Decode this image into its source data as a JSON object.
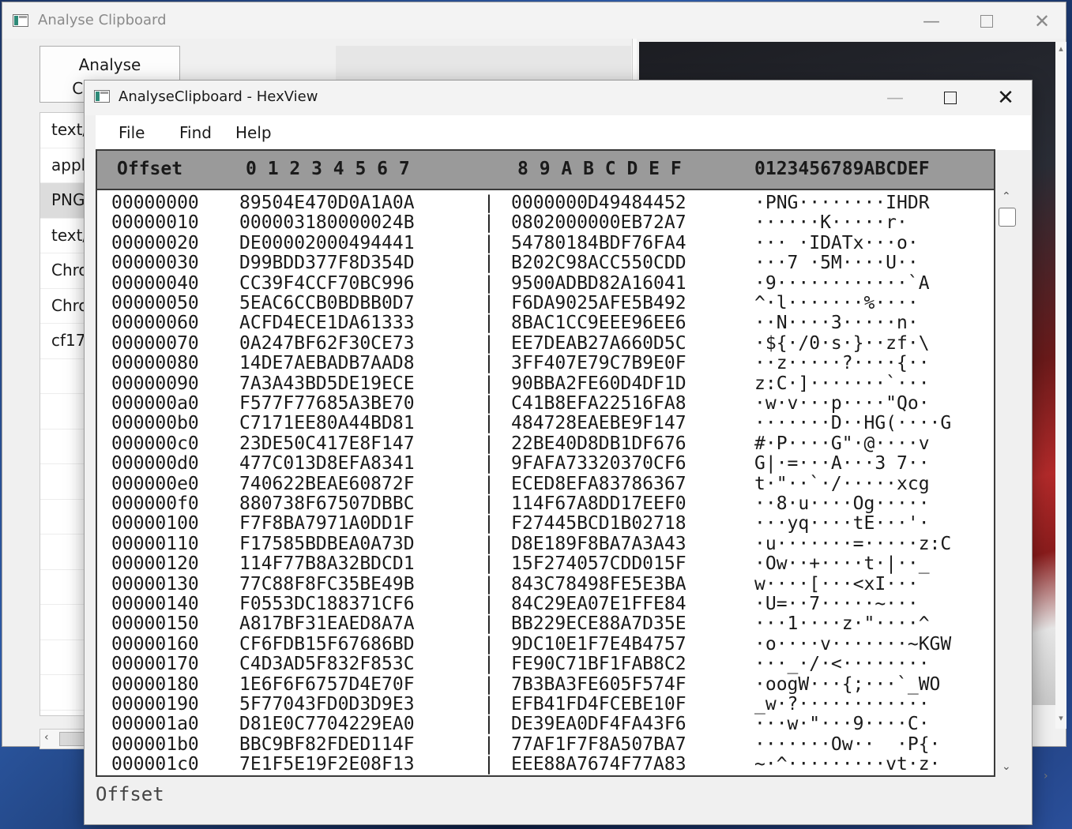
{
  "back_window": {
    "title": "Analyse Clipboard",
    "analyse_button": "Analyse\nClipboard",
    "types": [
      "text/",
      "appl",
      "PNG",
      "text/",
      "Chro",
      "Chro",
      "cf17"
    ],
    "selected_index": 2
  },
  "hexview": {
    "title": "AnalyseClipboard - HexView",
    "menu": [
      "File",
      "Find",
      "Help"
    ],
    "header": {
      "offset": "Offset",
      "cols_low": "0 1 2 3 4 5 6 7",
      "cols_high": "8 9 A B C D E F",
      "ascii": "0123456789ABCDEF"
    },
    "separator": "|",
    "rows": [
      {
        "offset": "00000000",
        "hex1": "89504E470D0A1A0A",
        "hex2": "0000000D49484452",
        "ascii": "·PNG········IHDR"
      },
      {
        "offset": "00000010",
        "hex1": "000003180000024B",
        "hex2": "0802000000EB72A7",
        "ascii": "······K·····r·"
      },
      {
        "offset": "00000020",
        "hex1": "DE00002000494441",
        "hex2": "54780184BDF76FA4",
        "ascii": "··· ·IDATx···o·"
      },
      {
        "offset": "00000030",
        "hex1": "D99BDD377F8D354D",
        "hex2": "B202C98ACC550CDD",
        "ascii": "···7 ·5M····U··"
      },
      {
        "offset": "00000040",
        "hex1": "CC39F4CCF70BC996",
        "hex2": "9500ADBD82A16041",
        "ascii": "·9············`A"
      },
      {
        "offset": "00000050",
        "hex1": "5EAC6CCB0BDBB0D7",
        "hex2": "F6DA9025AFE5B492",
        "ascii": "^·l·······%····"
      },
      {
        "offset": "00000060",
        "hex1": "ACFD4ECE1DA61333",
        "hex2": "8BAC1CC9EEE96EE6",
        "ascii": "··N····3·····n·"
      },
      {
        "offset": "00000070",
        "hex1": "0A247BF62F30CE73",
        "hex2": "EE7DEAB27A660D5C",
        "ascii": "·${·/0·s·}··zf·\\"
      },
      {
        "offset": "00000080",
        "hex1": "14DE7AEBADB7AAD8",
        "hex2": "3FF407E79C7B9E0F",
        "ascii": "··z·····?····{··"
      },
      {
        "offset": "00000090",
        "hex1": "7A3A43BD5DE19ECE",
        "hex2": "90BBA2FE60D4DF1D",
        "ascii": "z:C·]·······`···"
      },
      {
        "offset": "000000a0",
        "hex1": "F577F77685A3BE70",
        "hex2": "C41B8EFA22516FA8",
        "ascii": "·w·v···p····\"Qo·"
      },
      {
        "offset": "000000b0",
        "hex1": "C7171EE80A44BD81",
        "hex2": "484728EAEBE9F147",
        "ascii": "·······D··HG(····G"
      },
      {
        "offset": "000000c0",
        "hex1": "23DE50C417E8F147",
        "hex2": "22BE40D8DB1DF676",
        "ascii": "#·P····G\"·@····v"
      },
      {
        "offset": "000000d0",
        "hex1": "477C013D8EFA8341",
        "hex2": "9FAFA73320370CF6",
        "ascii": "G|·=···A···3 7··"
      },
      {
        "offset": "000000e0",
        "hex1": "740622BEAE60872F",
        "hex2": "ECED8EFA83786367",
        "ascii": "t·\"··`·/·····xcg"
      },
      {
        "offset": "000000f0",
        "hex1": "880738F67507DBBC",
        "hex2": "114F67A8DD17EEF0",
        "ascii": "··8·u····Og·····"
      },
      {
        "offset": "00000100",
        "hex1": "F7F8BA7971A0DD1F",
        "hex2": "F27445BCD1B02718",
        "ascii": "···yq····tE···'·"
      },
      {
        "offset": "00000110",
        "hex1": "F17585BDBEA0A73D",
        "hex2": "D8E189F8BA7A3A43",
        "ascii": "·u·······=·····z:C"
      },
      {
        "offset": "00000120",
        "hex1": "114F77B8A32BDCD1",
        "hex2": "15F274057CDD015F",
        "ascii": "·Ow··+····t·|··_"
      },
      {
        "offset": "00000130",
        "hex1": "77C88F8FC35BE49B",
        "hex2": "843C78498FE5E3BA",
        "ascii": "w····[···<xI···"
      },
      {
        "offset": "00000140",
        "hex1": "F0553DC188371CF6",
        "hex2": "84C29EA07E1FFE84",
        "ascii": "·U=··7·····~···"
      },
      {
        "offset": "00000150",
        "hex1": "A817BF31EAED8A7A",
        "hex2": "BB229ECE88A7D35E",
        "ascii": "···1····z·\"····^"
      },
      {
        "offset": "00000160",
        "hex1": "CF6FDB15F67686BD",
        "hex2": "9DC10E1F7E4B4757",
        "ascii": "·o····v·······~KGW"
      },
      {
        "offset": "00000170",
        "hex1": "C4D3AD5F832F853C",
        "hex2": "FE90C71BF1FAB8C2",
        "ascii": "···_·/·<········"
      },
      {
        "offset": "00000180",
        "hex1": "1E6F6F6757D4E70F",
        "hex2": "7B3BA3FE605F574F",
        "ascii": "·oogW···{;···`_WO"
      },
      {
        "offset": "00000190",
        "hex1": "5F77043FD0D3D9E3",
        "hex2": "EFB41FD4FCEBE10F",
        "ascii": "_w·?············"
      },
      {
        "offset": "000001a0",
        "hex1": "D81E0C7704229EA0",
        "hex2": "DE39EA0DF4FA43F6",
        "ascii": "···w·\"···9····C·"
      },
      {
        "offset": "000001b0",
        "hex1": "BBC9BF82FDED114F",
        "hex2": "77AF1F7F8A507BA7",
        "ascii": "·······Ow··  ·P{·"
      },
      {
        "offset": "000001c0",
        "hex1": "7E1F5E19F2E08F13",
        "hex2": "EEE88A7674F77A83",
        "ascii": "~·^·········vt·z·"
      }
    ],
    "status": "Offset"
  }
}
